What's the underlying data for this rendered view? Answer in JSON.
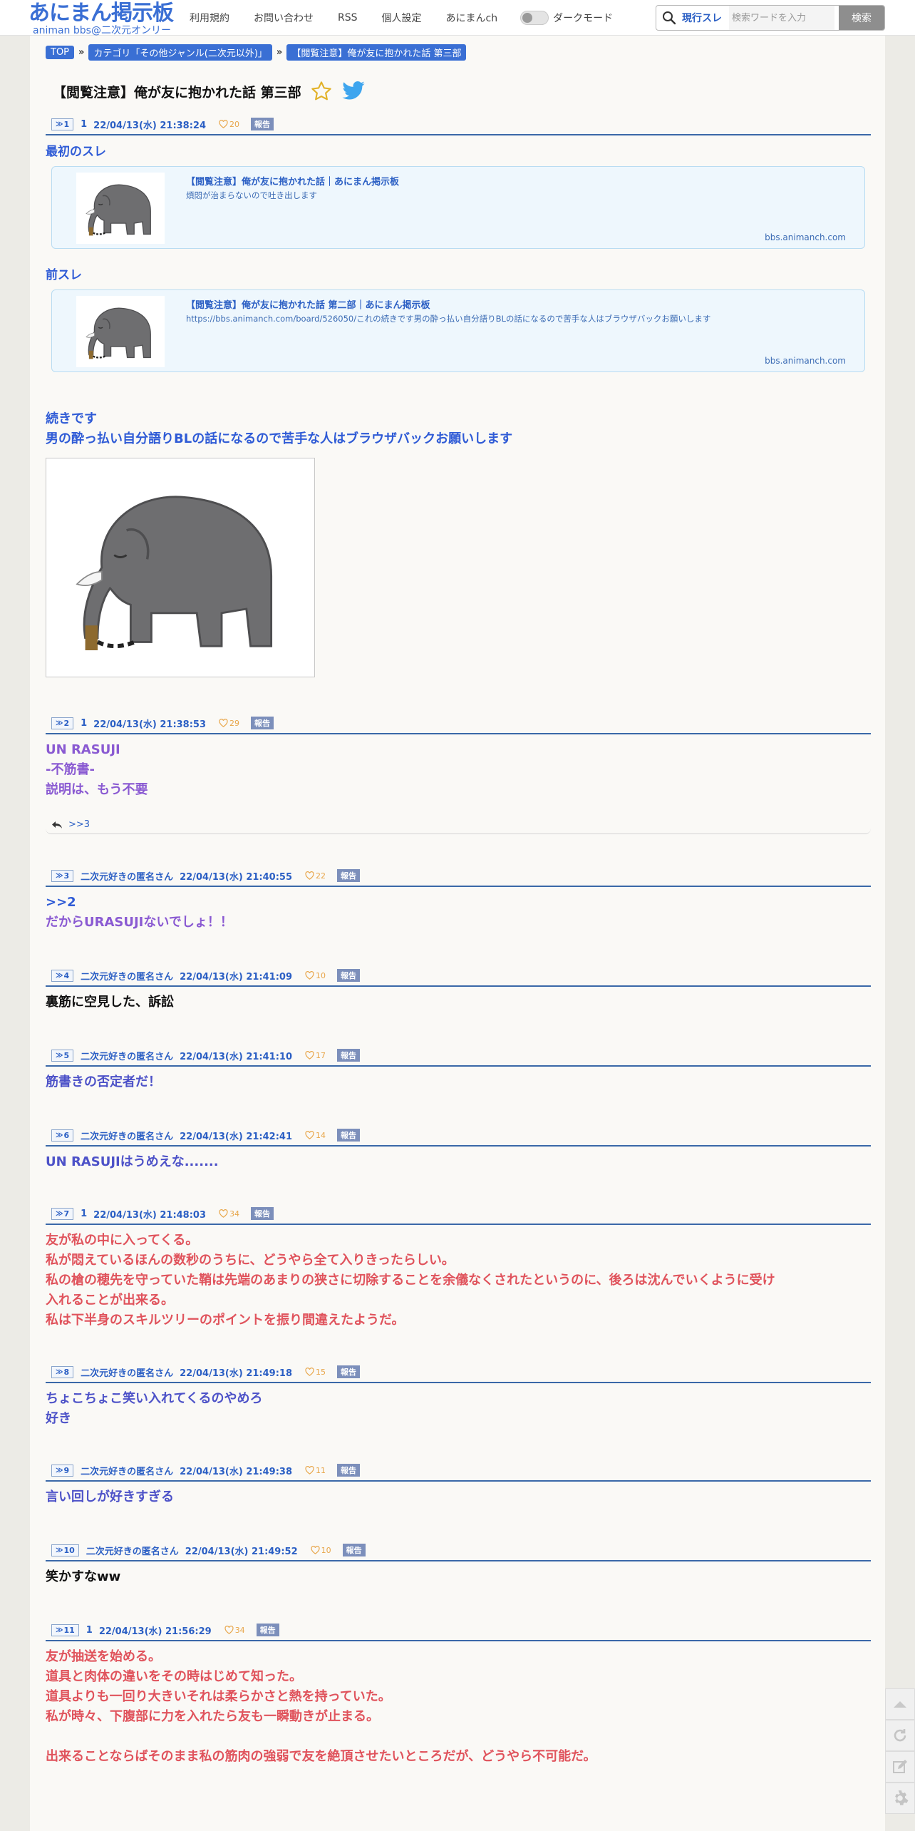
{
  "header": {
    "logo_main": "あにまん掲示板",
    "logo_sub": "animan bbs@二次元オンリー",
    "nav": [
      "利用規約",
      "お問い合わせ",
      "RSS",
      "個人設定",
      "あにまんch"
    ],
    "dark_mode_label": "ダークモード",
    "search_scope": "現行スレ",
    "search_placeholder": "検索ワードを入力",
    "search_button": "検索"
  },
  "breadcrumb": [
    "TOP",
    "カテゴリ「その他ジャンル(二次元以外)」",
    "【閲覧注意】俺が友に抱かれた話 第三部"
  ],
  "breadcrumb_sep": "»",
  "thread_title": "【閲覧注意】俺が友に抱かれた話 第三部",
  "report_label": "報告",
  "op": {
    "num": "1",
    "name": "1",
    "date": "22/04/13(水) 21:38:24",
    "likes": "20",
    "first_label": "最初のスレ",
    "card1": {
      "title": "【閲覧注意】俺が友に抱かれた話｜あにまん掲示板",
      "desc": "煩悶が治まらないので吐き出します",
      "domain": "bbs.animanch.com"
    },
    "prev_label": "前スレ",
    "card2": {
      "title": "【閲覧注意】俺が友に抱かれた話 第二部｜あにまん掲示板",
      "desc": "https://bbs.animanch.com/board/526050/これの続きです男の酔っ払い自分語りBLの話になるので苦手な人はブラウザバックお願いします",
      "domain": "bbs.animanch.com"
    },
    "body_line1": "続きです",
    "body_line2": "男の酔っ払い自分語りBLの話になるので苦手な人はブラウザバックお願いします"
  },
  "posts": [
    {
      "num": "2",
      "name": "1",
      "date": "22/04/13(水) 21:38:53",
      "likes": "29",
      "lines": [
        "UN RASUJI",
        "-不筋書-",
        "説明は、もう不要"
      ],
      "reply": ">>3"
    },
    {
      "num": "3",
      "name": "二次元好きの匿名さん",
      "date": "22/04/13(水) 21:40:55",
      "likes": "22",
      "anchor": ">>2",
      "lines": [
        "だからURASUJIないでしょ！！"
      ]
    },
    {
      "num": "4",
      "name": "二次元好きの匿名さん",
      "date": "22/04/13(水) 21:41:09",
      "likes": "10",
      "lines": [
        "裏筋に空見した、訴訟"
      ]
    },
    {
      "num": "5",
      "name": "二次元好きの匿名さん",
      "date": "22/04/13(水) 21:41:10",
      "likes": "17",
      "lines": [
        "筋書きの否定者だ！"
      ]
    },
    {
      "num": "6",
      "name": "二次元好きの匿名さん",
      "date": "22/04/13(水) 21:42:41",
      "likes": "14",
      "lines": [
        "UN RASUJIはうめえな......."
      ]
    },
    {
      "num": "7",
      "name": "1",
      "date": "22/04/13(水) 21:48:03",
      "likes": "34",
      "lines": [
        "友が私の中に入ってくる。",
        "私が悶えているほんの数秒のうちに、どうやら全て入りきったらしい。",
        "私の槍の穂先を守っていた鞘は先端のあまりの狭さに切除することを余儀なくされたというのに、後ろは沈んでいくように受け",
        "入れることが出来る。",
        "私は下半身のスキルツリーのポイントを振り間違えたようだ。"
      ]
    },
    {
      "num": "8",
      "name": "二次元好きの匿名さん",
      "date": "22/04/13(水) 21:49:18",
      "likes": "15",
      "lines": [
        "ちょこちょこ笑い入れてくるのやめろ",
        "好き"
      ]
    },
    {
      "num": "9",
      "name": "二次元好きの匿名さん",
      "date": "22/04/13(水) 21:49:38",
      "likes": "11",
      "lines": [
        "言い回しが好きすぎる"
      ]
    },
    {
      "num": "10",
      "name": "二次元好きの匿名さん",
      "date": "22/04/13(水) 21:49:52",
      "likes": "10",
      "lines": [
        "笑かすなww"
      ]
    },
    {
      "num": "11",
      "name": "1",
      "date": "22/04/13(水) 21:56:29",
      "likes": "34",
      "lines": [
        "友が抽送を始める。",
        "道具と肉体の違いをその時はじめて知った。",
        "道具よりも一回り大きいそれは柔らかさと熱を持っていた。",
        "私が時々、下腹部に力を入れたら友も一瞬動きが止まる。",
        "",
        "出来ることならばそのまま私の筋肉の強弱で友を絶頂させたいところだが、どうやら不可能だ。"
      ]
    }
  ],
  "colors": {
    "accent": "#3a6fd4",
    "blue_text": "#2f5bd6",
    "purple_text": "#8a5ad2",
    "indigo_text": "#4d52c8",
    "red_text": "#e0535c",
    "like": "#e8a64a",
    "report_bg": "#7c8fbb",
    "card_bg": "#eef7fd"
  },
  "icons": {
    "title_star": "star-outline-icon",
    "title_twitter": "twitter-bird-icon",
    "search": "magnifier-icon",
    "like": "heart-outline-icon",
    "reply": "reply-arrow-icon",
    "side": [
      "scroll-top-icon",
      "reload-icon",
      "edit-icon",
      "settings-gear-icon"
    ]
  }
}
